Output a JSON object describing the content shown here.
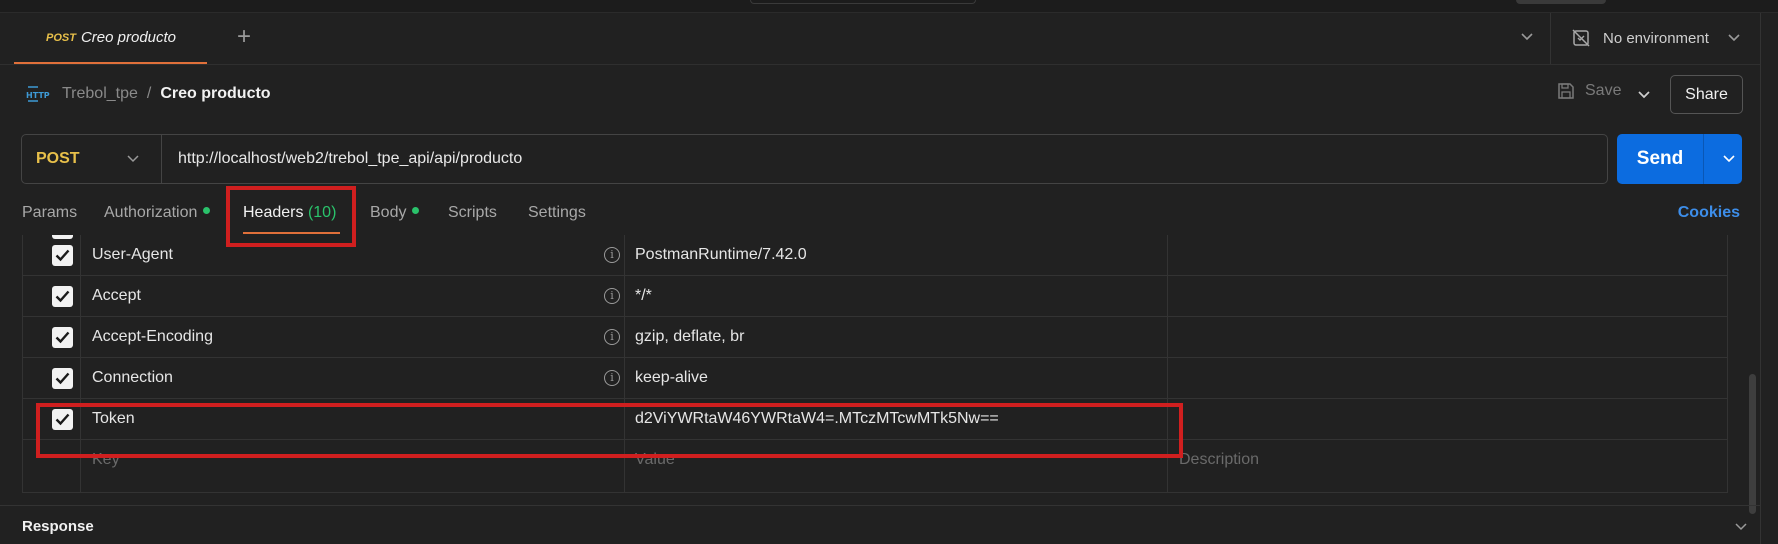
{
  "tab": {
    "method": "POST",
    "title": "Creo producto"
  },
  "environment": {
    "label": "No environment"
  },
  "breadcrumb": {
    "icon_text": "HTTP",
    "parent": "Trebol_tpe",
    "separator": "/",
    "current": "Creo producto"
  },
  "actions": {
    "save_label": "Save",
    "share_label": "Share"
  },
  "request": {
    "method": "POST",
    "url": "http://localhost/web2/trebol_tpe_api/api/producto",
    "send_label": "Send"
  },
  "request_tabs": [
    {
      "label": "Params"
    },
    {
      "label": "Authorization",
      "dot": true
    },
    {
      "label": "Headers",
      "count": "(10)",
      "active": true
    },
    {
      "label": "Body",
      "dot": true
    },
    {
      "label": "Scripts"
    },
    {
      "label": "Settings"
    }
  ],
  "cookies_label": "Cookies",
  "headers": [
    {
      "key": "User-Agent",
      "value": "PostmanRuntime/7.42.0",
      "checked": true,
      "info": true
    },
    {
      "key": "Accept",
      "value": "*/*",
      "checked": true,
      "info": true
    },
    {
      "key": "Accept-Encoding",
      "value": "gzip, deflate, br",
      "checked": true,
      "info": true
    },
    {
      "key": "Connection",
      "value": "keep-alive",
      "checked": true,
      "info": true
    },
    {
      "key": "Token",
      "value": "d2ViYWRtaW46YWRtaW4=.MTczMTcwMTk5Nw==",
      "checked": true,
      "info": false
    }
  ],
  "new_row": {
    "key_placeholder": "Key",
    "value_placeholder": "Value",
    "description_placeholder": "Description"
  },
  "response_label": "Response",
  "colors": {
    "accent_orange": "#e0703a",
    "method_yellow": "#e8c04a",
    "send_blue": "#0c6ce0",
    "highlight_red": "#d01f1f",
    "status_green": "#2ac26b"
  }
}
